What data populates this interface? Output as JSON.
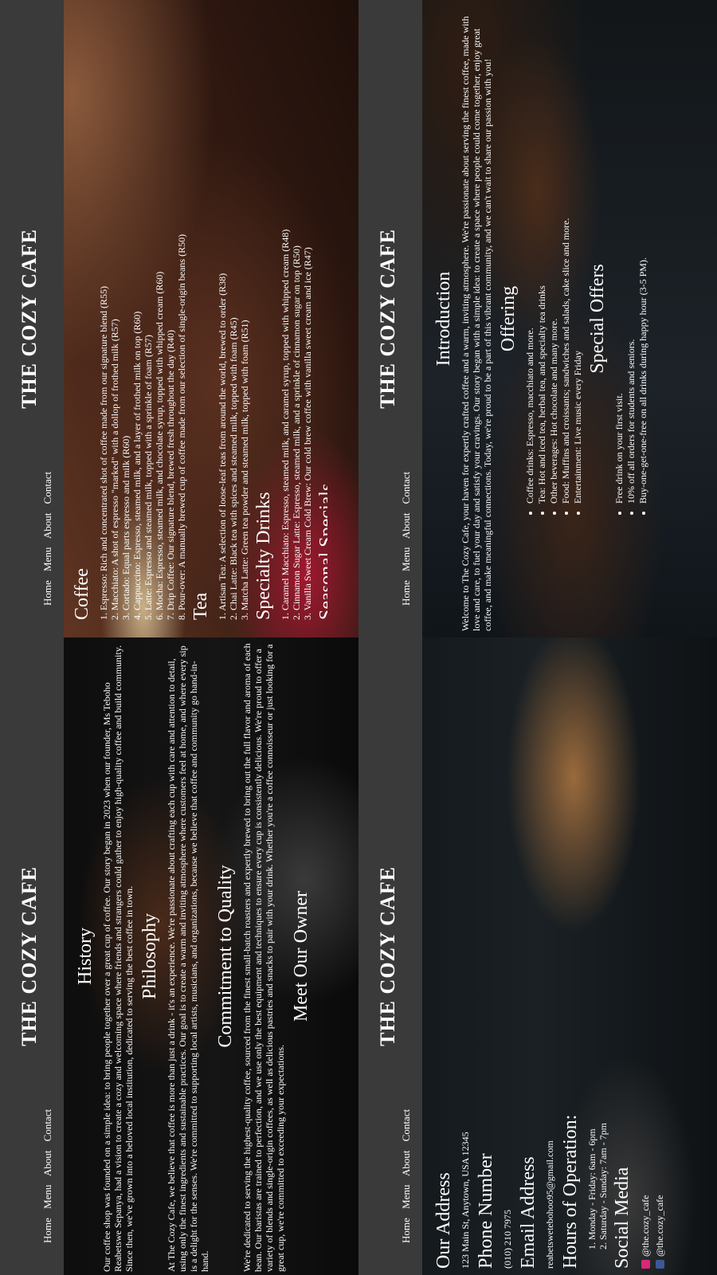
{
  "site": {
    "brand": "THE COZY CAFE",
    "nav": [
      "Home",
      "Menu",
      "About",
      "Contact"
    ]
  },
  "menu_page": {
    "sections": [
      {
        "title": "Coffee",
        "items": [
          "1. Espresso: Rich and concentrated shot of coffee made from our signature blend (R55)",
          "2. Macchiato: A shot of espresso \"marked\" with a dollop of frothed milk (R57)",
          "3. Cortado: Equal parts espresso and milk (R60)",
          "4. Cappuccino: Espresso, steamed milk, and a layer of frothed milk on top (R60)",
          "5. Latte: Espresso and steamed milk, topped with a sprinkle of foam (R57)",
          "6. Mocha: Espresso, steamed milk, and chocolate syrup, topped with whipped cream (R60)",
          "7. Drip Coffee: Our signature blend, brewed fresh throughout the day (R40)",
          "8. Pour-over: A manually brewed cup of coffee made from our selection of single-origin beans (R50)"
        ]
      },
      {
        "title": "Tea",
        "items": [
          "1. Artisan Tea: A selection of loose-leaf teas from around the world, brewed to order (R38)",
          "2. Chai Latte: Black tea with spices and steamed milk, topped with foam (R45)",
          "3. Matcha Latte: Green tea powder and steamed milk, topped with foam (R51)"
        ]
      },
      {
        "title": "Specialty Drinks",
        "items": [
          "1. Caramel Macchiato: Espresso, steamed milk, and caramel syrup, topped with whipped cream (R48)",
          "2. Cinnamon Sugar Latte: Espresso, steamed milk, and a sprinkle of cinnamon sugar on top (R50)",
          "3. Vanilla Sweet Cream Cold Brew: Our cold brew coffee with vanilla sweet cream and ice (R47)"
        ]
      }
    ],
    "cut_heading": "Seasonal Specials"
  },
  "home_page": {
    "intro_title": "Introduction",
    "intro_text": "Welcome to The Cozy Cafe, your haven for expertly crafted coffee and a warm, inviting atmosphere. We're passionate about serving the finest coffee, made with love and care, to fuel your day and satisfy your cravings. Our story began with a simple idea: to create a space where people could come together, enjoy great coffee, and make meaningful connections. Today, we're proud to be a part of this vibrant community, and we can't wait to share our passion with you!",
    "offering_title": "Offering",
    "offering_items": [
      "Coffee drinks: Espresso, macchiato and more.",
      "Tea: Hot and iced tea, herbal tea, and specialty tea drinks",
      "Other beverages: Hot chocolate and many more.",
      "Food: Muffins and croissants; sandwiches and salads, cake slice and more.",
      "Entertainment: Live music every Friday"
    ],
    "offers_title": "Special Offers",
    "offers_items": [
      "Free drink on your first visit.",
      "10% off all orders for students and seniors.",
      "Buy-one-get-one-free on all drinks during happy hour (3-5 PM)."
    ]
  },
  "about_page": {
    "history_title": "History",
    "history_text": "Our coffee shop was founded on a simple idea: to bring people together over a great cup of coffee. Our story began in 2023 when our founder, Ms Teboho Reabetswe Sepanya, had a vision to create a cozy and welcoming space where friends and strangers could gather to enjoy high-quality coffee and build community. Since then, we've grown into a beloved local institution, dedicated to serving the best coffee in town.",
    "philosophy_title": "Philosophy",
    "philosophy_text": "At The Cozy Cafe, we believe that coffee is more than just a drink - it's an experience. We're passionate about crafting each cup with care and attention to detail, using only the finest ingredients and sustainable practices. Our goal is to create a warm and inviting atmosphere where customers feel at home, and where every sip is a delight for the senses. We're committed to supporting local artists, musicians, and organizations, because we believe that coffee and community go hand-in-hand.",
    "quality_title": "Commitment to Quality",
    "quality_text": "We're dedicated to serving the highest-quality coffee, sourced from the finest small-batch roasters and expertly brewed to bring out the full flavor and aroma of each bean. Our baristas are trained to perfection, and we use only the best equipment and techniques to ensure every cup is consistently delicious. We're proud to offer a variety of blends and single-origin coffees, as well as delicious pastries and snacks to pair with your drink. Whether you're a coffee connoisseur or just looking for a great cup, we're committed to exceeding your expectations.",
    "owner_title": "Meet Our Owner"
  },
  "contact_page": {
    "address_title": "Our Address",
    "address": "123 Main St, Anytown, USA 12345",
    "phone_title": "Phone Number",
    "phone": "(010) 210 7975",
    "email_title": "Email Address",
    "email": "reabetswetebohoo95@gmail.com",
    "hours_title": "Hours of Operation:",
    "hours": [
      "1. Monday - Friday: 6am - 6pm",
      "2. Saturday - Sunday: 7am - 7pm"
    ],
    "social_title": "Social Media",
    "social": [
      {
        "icon": "instagram-icon",
        "handle": "@the.cozy_cafe"
      },
      {
        "icon": "facebook-icon",
        "handle": "@the.cozy_cafe"
      }
    ]
  },
  "colors": {
    "header": "#3a3a3a",
    "text": "#ffffff",
    "instagram": "#d62976",
    "facebook": "#3b5998"
  }
}
